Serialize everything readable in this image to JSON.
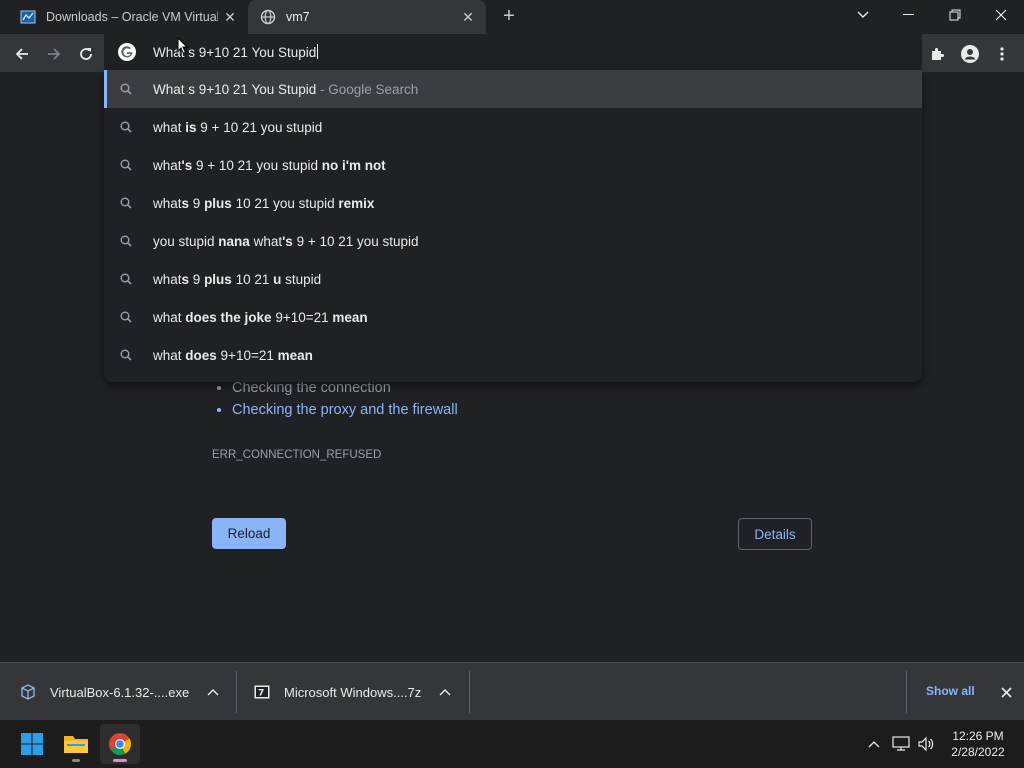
{
  "tabs": [
    {
      "title": "Downloads – Oracle VM VirtualBox",
      "icon": "virtualbox-icon"
    },
    {
      "title": "vm7",
      "icon": "globe-icon"
    }
  ],
  "omnibox": {
    "text": "What s 9+10 21 You Stupid"
  },
  "suggestions": [
    {
      "parts": [
        {
          "t": "What s 9+10 21 You Stupid",
          "b": false
        }
      ],
      "suffix": " - Google Search",
      "selected": true
    },
    {
      "parts": [
        {
          "t": "what ",
          "b": false
        },
        {
          "t": "is",
          "b": true
        },
        {
          "t": " 9 + 10 21 you stupid",
          "b": false
        }
      ]
    },
    {
      "parts": [
        {
          "t": "what",
          "b": false
        },
        {
          "t": "'s",
          "b": true
        },
        {
          "t": " 9 + 10 21 you stupid ",
          "b": false
        },
        {
          "t": "no i'm not",
          "b": true
        }
      ]
    },
    {
      "parts": [
        {
          "t": "what",
          "b": false
        },
        {
          "t": "s",
          "b": true
        },
        {
          "t": " 9 ",
          "b": false
        },
        {
          "t": "plus",
          "b": true
        },
        {
          "t": " 10 21 you stupid ",
          "b": false
        },
        {
          "t": "remix",
          "b": true
        }
      ]
    },
    {
      "parts": [
        {
          "t": "you stupid ",
          "b": false
        },
        {
          "t": "nana",
          "b": true
        },
        {
          "t": " what",
          "b": false
        },
        {
          "t": "'s",
          "b": true
        },
        {
          "t": " 9 + 10 21 you stupid",
          "b": false
        }
      ]
    },
    {
      "parts": [
        {
          "t": "what",
          "b": false
        },
        {
          "t": "s",
          "b": true
        },
        {
          "t": " 9 ",
          "b": false
        },
        {
          "t": "plus",
          "b": true
        },
        {
          "t": " 10 21 ",
          "b": false
        },
        {
          "t": "u",
          "b": true
        },
        {
          "t": " stupid",
          "b": false
        }
      ]
    },
    {
      "parts": [
        {
          "t": "what ",
          "b": false
        },
        {
          "t": "does the joke",
          "b": true
        },
        {
          "t": " 9+10=21 ",
          "b": false
        },
        {
          "t": "mean",
          "b": true
        }
      ]
    },
    {
      "parts": [
        {
          "t": "what ",
          "b": false
        },
        {
          "t": "does",
          "b": true
        },
        {
          "t": " 9+10=21 ",
          "b": false
        },
        {
          "t": "mean",
          "b": true
        }
      ]
    }
  ],
  "error_page": {
    "bullets": [
      "Checking the connection",
      "Checking the proxy and the firewall"
    ],
    "error_code": "ERR_CONNECTION_REFUSED",
    "reload_label": "Reload",
    "details_label": "Details"
  },
  "downloads": {
    "items": [
      {
        "name": "VirtualBox-6.1.32-....exe",
        "icon": "virtualbox-installer-icon"
      },
      {
        "name": "Microsoft Windows....7z",
        "icon": "7zip-archive-icon"
      }
    ],
    "show_all_label": "Show all"
  },
  "taskbar": {
    "time": "12:26 PM",
    "date": "2/28/2022"
  },
  "colors": {
    "accent_blue": "#8ab4f8",
    "page_bg": "#202124",
    "toolbar_bg": "#35363a"
  }
}
